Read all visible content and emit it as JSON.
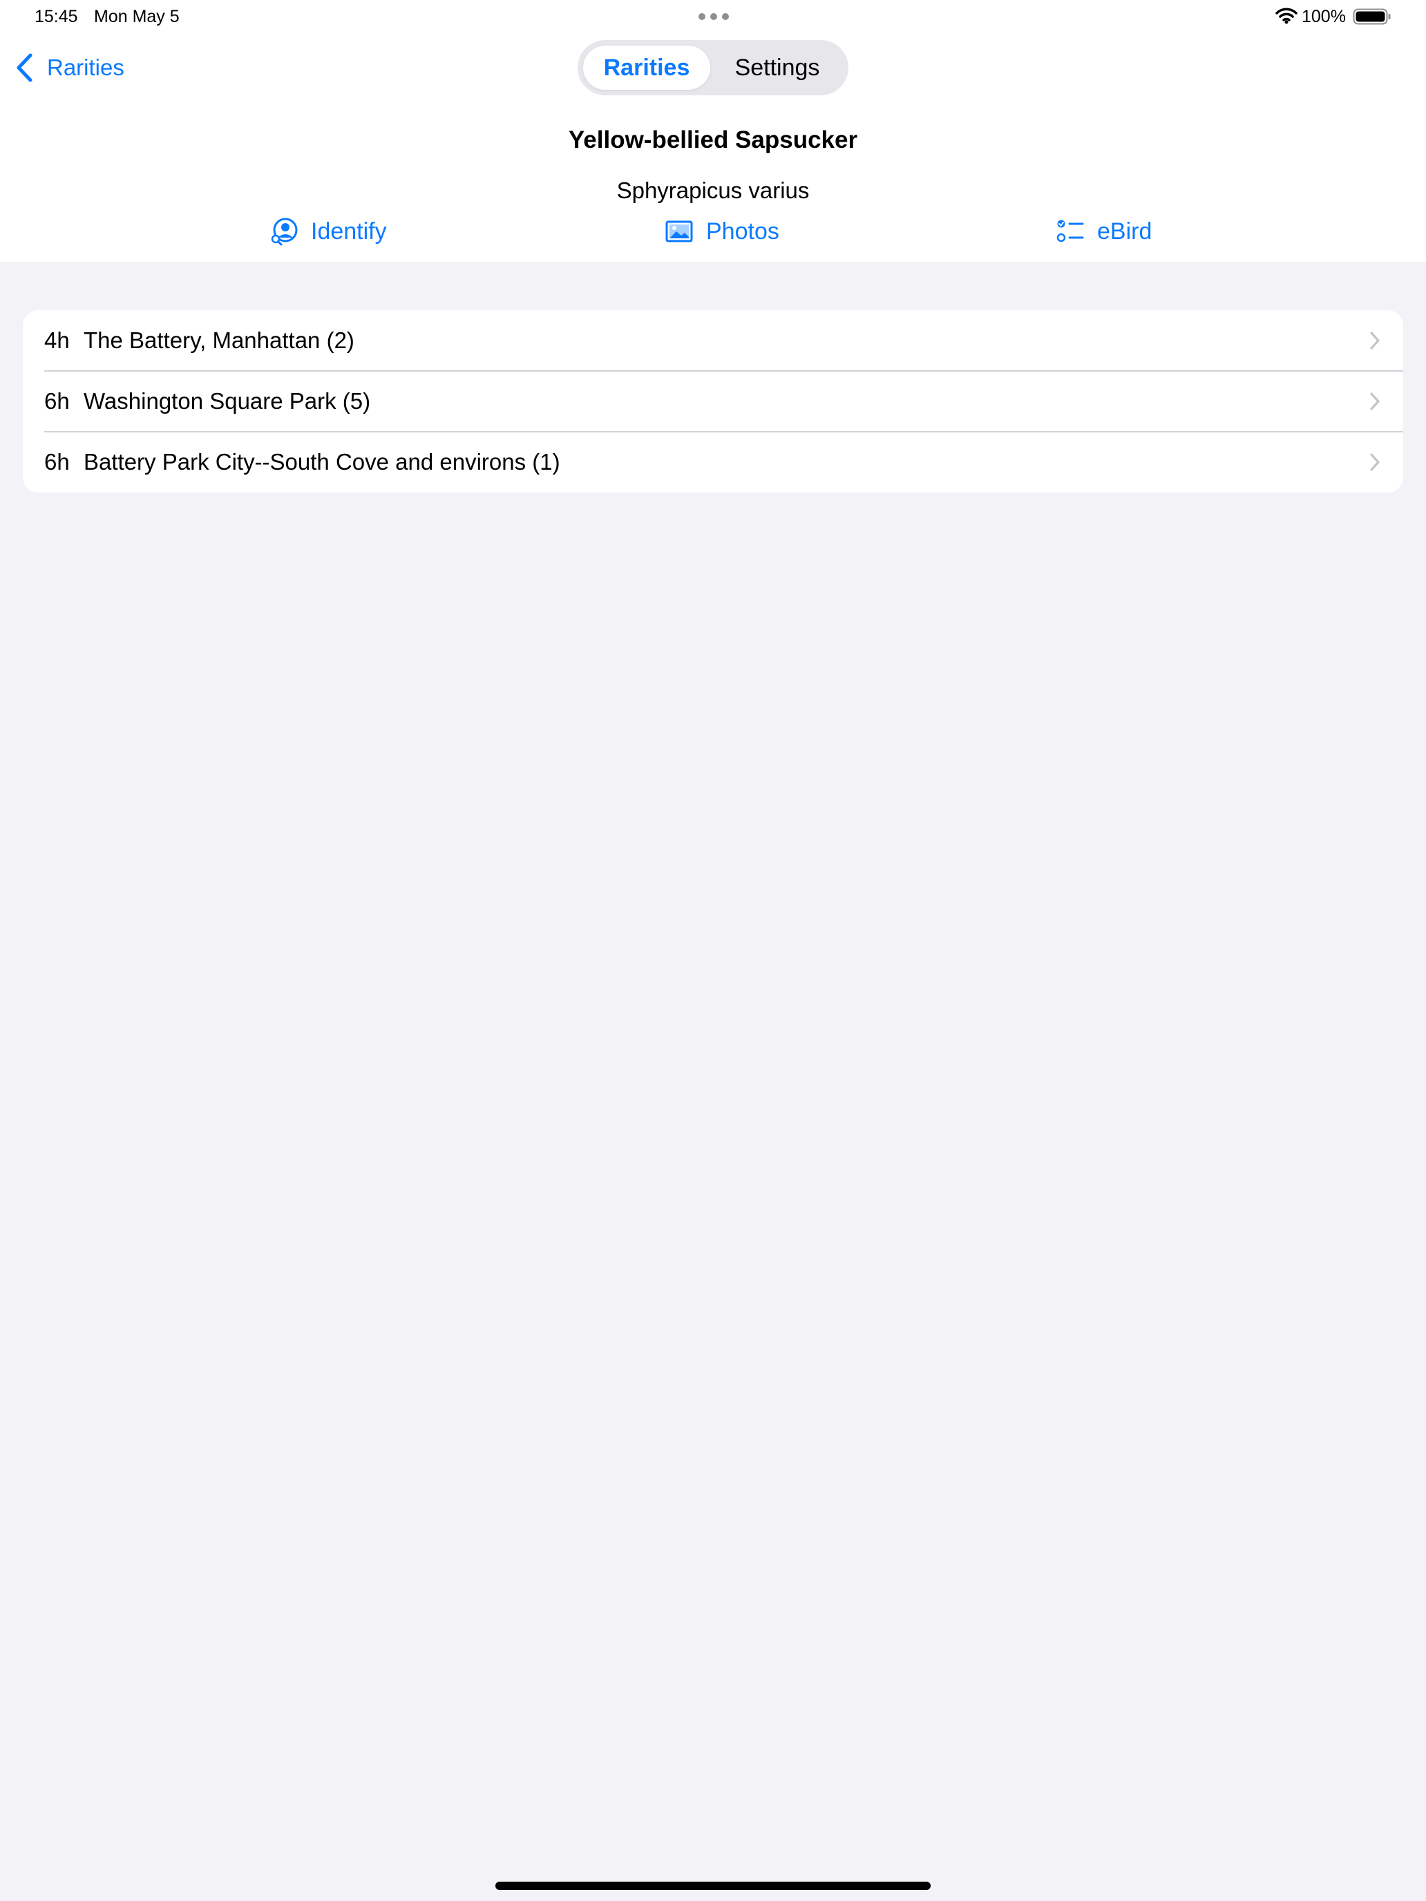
{
  "status_bar": {
    "time": "15:45",
    "date": "Mon May 5",
    "battery": "100%"
  },
  "nav": {
    "back_label": "Rarities",
    "segments": [
      {
        "label": "Rarities",
        "selected": true
      },
      {
        "label": "Settings",
        "selected": false
      }
    ]
  },
  "species": {
    "common_name": "Yellow-bellied Sapsucker",
    "scientific_name": "Sphyrapicus varius"
  },
  "actions": [
    {
      "label": "Identify",
      "icon": "identify-icon"
    },
    {
      "label": "Photos",
      "icon": "photo-icon"
    },
    {
      "label": "eBird",
      "icon": "checklist-icon"
    }
  ],
  "sightings": [
    {
      "age": "4h",
      "place": "The Battery, Manhattan  (2)"
    },
    {
      "age": "6h",
      "place": "Washington Square Park  (5)"
    },
    {
      "age": "6h",
      "place": "Battery Park City--South Cove and environs  (1)"
    }
  ],
  "colors": {
    "accent": "#0a7aff",
    "background": "#f2f2f7",
    "separator": "#d1d1d6"
  }
}
